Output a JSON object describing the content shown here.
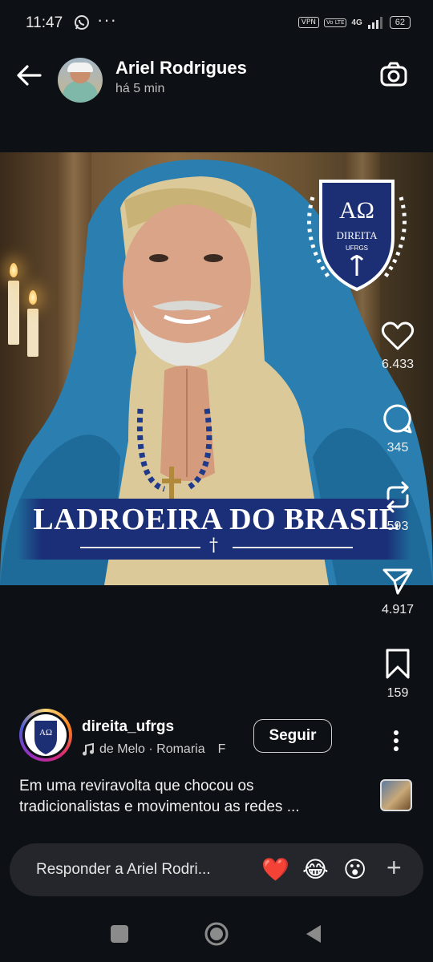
{
  "status_bar": {
    "time": "11:47",
    "vpn": "VPN",
    "volte": "Vo LTE",
    "network": "4G",
    "battery": "62"
  },
  "header": {
    "user_name": "Ariel Rodrigues",
    "timestamp": "há 5 min"
  },
  "post": {
    "banner_text": "LADROEIRA DO BRASIL",
    "crest_letters": "ΑΩ",
    "crest_name": "DIREITA",
    "crest_sub": "UFRGS"
  },
  "actions": {
    "likes": "6.433",
    "comments": "345",
    "reposts": "593",
    "shares": "4.917",
    "saves": "159"
  },
  "account": {
    "name": "direita_ufrgs",
    "music": "de Melo · Romaria",
    "music_overflow": "F",
    "follow_label": "Seguir"
  },
  "caption": {
    "line1": "Em uma reviravolta que chocou os",
    "line2": "tradicionalistas e movimentou as redes ..."
  },
  "reply": {
    "placeholder": "Responder a Ariel Rodri...",
    "emojis": [
      "❤️",
      "😂",
      "😮"
    ]
  },
  "colors": {
    "background": "#0d1014",
    "banner": "#1b2f78",
    "veil": "#2a7fb0",
    "heart_emoji": "#e3262e"
  }
}
